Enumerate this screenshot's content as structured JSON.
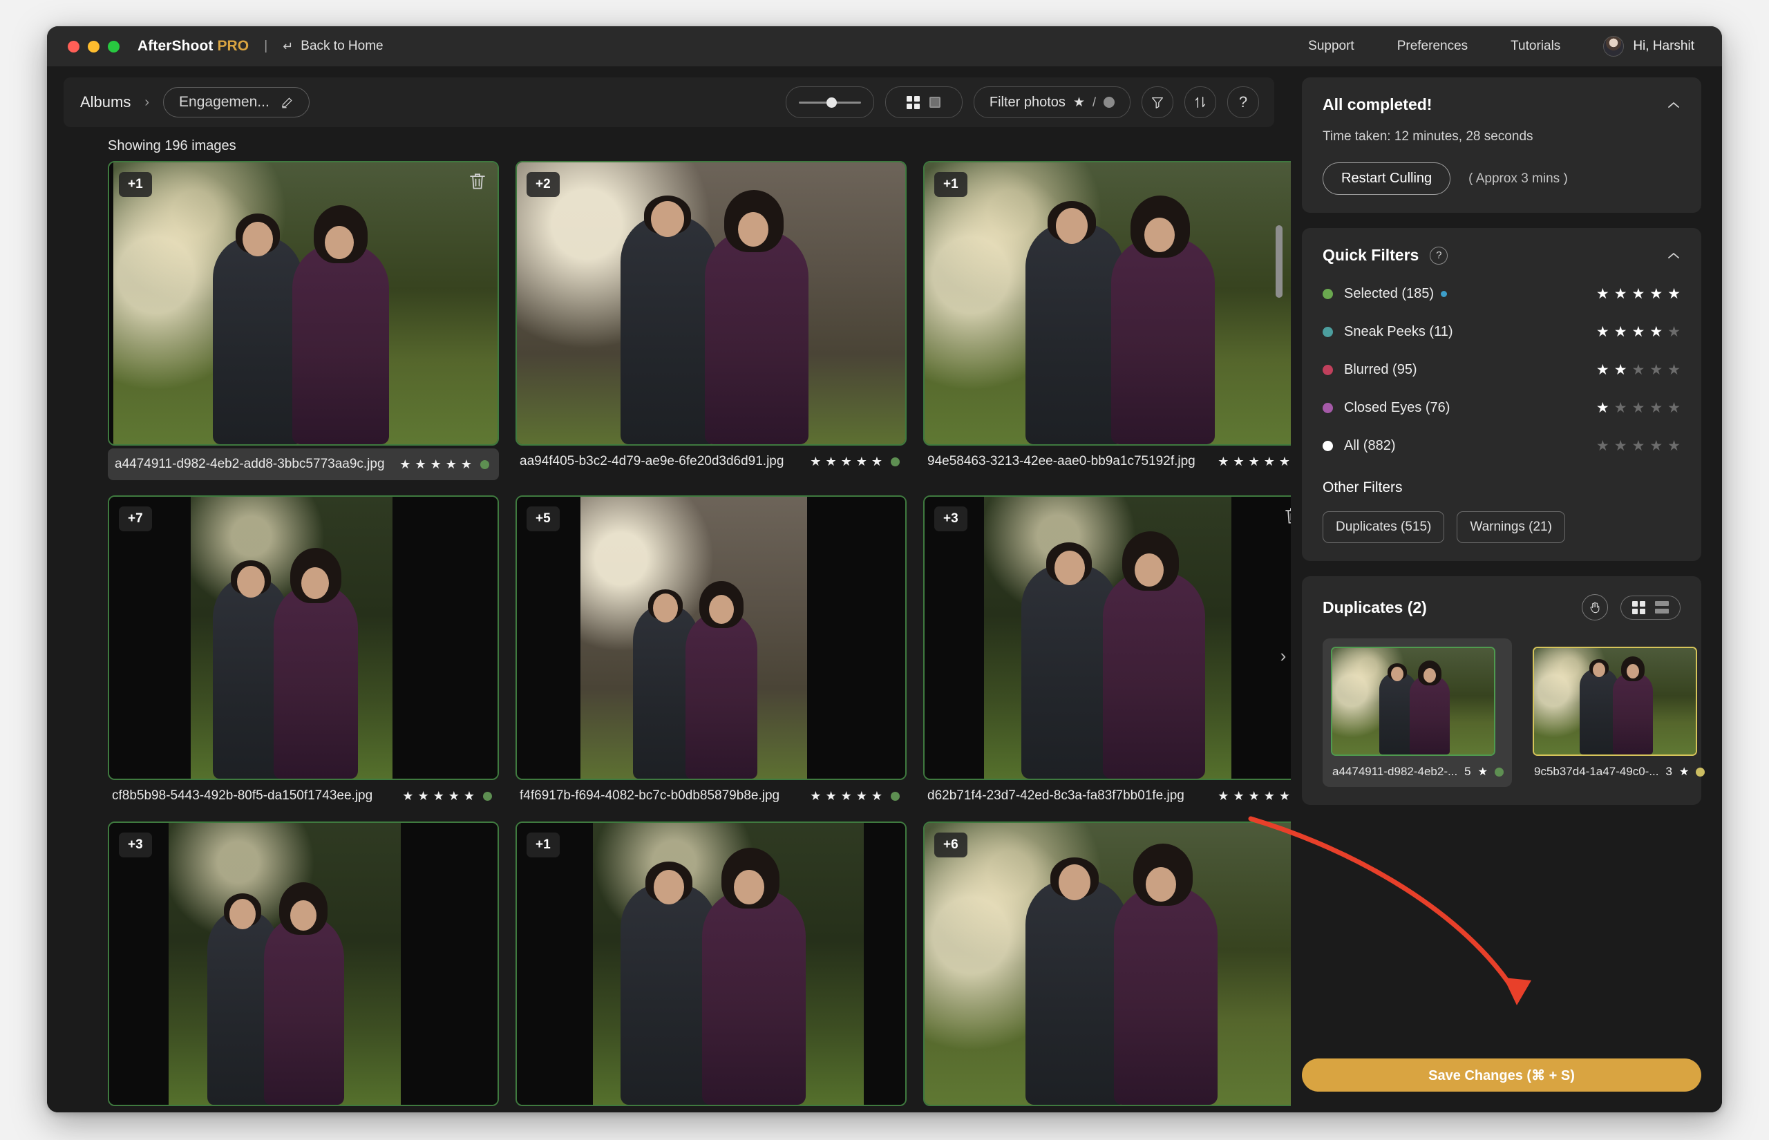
{
  "window": {
    "brand_name": "AfterShoot",
    "brand_suffix": "PRO",
    "divider": "|",
    "back_to_home": "Back to Home",
    "back_icon": "↵",
    "nav": [
      {
        "label": "Support"
      },
      {
        "label": "Preferences"
      },
      {
        "label": "Tutorials"
      }
    ],
    "user_greeting": "Hi, Harshit"
  },
  "gallery": {
    "breadcrumb": {
      "root": "Albums",
      "separator": "›",
      "album": "Engagemen...",
      "edit_icon": "pencil-icon"
    },
    "toolbar": {
      "zoom_slider_value": 45,
      "view_grid_icon": "grid-view-icon",
      "view_single_icon": "single-view-icon",
      "filter_photos_label": "Filter photos",
      "filter_star_glyph": "★",
      "filter_slash": "/",
      "funnel_icon": "funnel-icon",
      "sort_icon": "sort-icon",
      "help_label": "?"
    },
    "showing_count": "Showing 196 images",
    "photos": [
      {
        "badge": "+1",
        "filename": "a4474911-d982-4eb2-add8-3bbc5773aa9c.jpg",
        "stars": 5,
        "dot_color": "#5e8f52",
        "has_trash": true,
        "highlight": true,
        "scene": "garden"
      },
      {
        "badge": "+2",
        "filename": "aa94f405-b3c2-4d79-ae9e-6fe20d3d6d91.jpg",
        "stars": 5,
        "dot_color": "#5e8f52",
        "has_trash": false,
        "highlight": false,
        "scene": "wall"
      },
      {
        "badge": "+1",
        "filename": "94e58463-3213-42ee-aae0-bb9a1c75192f.jpg",
        "stars": 5,
        "dot_color": "#5e8f52",
        "has_trash": false,
        "highlight": false,
        "scene": "garden"
      },
      {
        "badge": "+7",
        "filename": "cf8b5b98-5443-492b-80f5-da150f1743ee.jpg",
        "stars": 5,
        "dot_color": "#5e8f52",
        "has_trash": false,
        "highlight": false,
        "scene": "tree"
      },
      {
        "badge": "+5",
        "filename": "f4f6917b-f694-4082-bc7c-b0db85879b8e.jpg",
        "stars": 5,
        "dot_color": "#5e8f52",
        "has_trash": false,
        "highlight": false,
        "scene": "wall"
      },
      {
        "badge": "+3",
        "filename": "d62b71f4-23d7-42ed-8c3a-fa83f7bb01fe.jpg",
        "stars": 5,
        "dot_color": "#5e8f52",
        "has_trash": true,
        "highlight": false,
        "scene": "tree"
      },
      {
        "badge": "+3",
        "filename": "",
        "stars": 0,
        "dot_color": "#5e8f52",
        "has_trash": false,
        "highlight": false,
        "scene": "tree"
      },
      {
        "badge": "+1",
        "filename": "",
        "stars": 0,
        "dot_color": "#5e8f52",
        "has_trash": false,
        "highlight": false,
        "scene": "tree"
      },
      {
        "badge": "+6",
        "filename": "",
        "stars": 0,
        "dot_color": "#5e8f52",
        "has_trash": false,
        "highlight": false,
        "scene": "garden"
      }
    ],
    "collapse_chevron": "›"
  },
  "sidebar": {
    "status_panel": {
      "title": "All completed!",
      "time_taken": "Time taken: 12 minutes, 28 seconds",
      "restart_button": "Restart Culling",
      "restart_note": "( Approx 3 mins )",
      "collapse_icon": "chevron-up-icon"
    },
    "quick_filters": {
      "title": "Quick Filters",
      "help_label": "?",
      "collapse_icon": "chevron-up-icon",
      "rows": [
        {
          "label": "Selected (185)",
          "bullet_color": "#6aa84f",
          "stars": 5,
          "active": true
        },
        {
          "label": "Sneak Peeks (11)",
          "bullet_color": "#4c9e9e",
          "stars": 4,
          "active": false
        },
        {
          "label": "Blurred (95)",
          "bullet_color": "#c0405c",
          "stars": 2,
          "active": false
        },
        {
          "label": "Closed Eyes (76)",
          "bullet_color": "#a55aa8",
          "stars": 1,
          "active": false
        },
        {
          "label": "All (882)",
          "bullet_color": "#ffffff",
          "stars": 0,
          "active": false
        }
      ],
      "other_filters_title": "Other Filters",
      "other_filters": [
        {
          "label": "Duplicates (515)"
        },
        {
          "label": "Warnings (21)"
        }
      ]
    },
    "duplicates_panel": {
      "title": "Duplicates (2)",
      "hand_icon": "hand-icon",
      "view_toggle_icon": "grid-rows-toggle-icon",
      "items": [
        {
          "filename": "a4474911-d982-4eb2-...",
          "rating": "5",
          "star": "★",
          "dot_color": "#5e8f52",
          "border_color": "#4f9a4f",
          "selected": true,
          "scene": "garden"
        },
        {
          "filename": "9c5b37d4-1a47-49c0-...",
          "rating": "3",
          "star": "★",
          "dot_color": "#ccbd62",
          "border_color": "#d6c45a",
          "selected": false,
          "scene": "garden2"
        }
      ]
    },
    "save_changes_label": "Save Changes (⌘ + S)"
  },
  "colors": {
    "accent_gold": "#d9a441",
    "window_bg": "#1b1b1b",
    "panel_bg": "#2a2a2a",
    "selected_green": "#3f7a3f",
    "annotation_red": "#e8402a"
  }
}
